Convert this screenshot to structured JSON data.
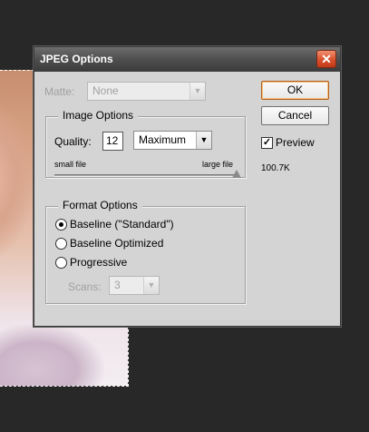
{
  "dialog": {
    "title": "JPEG Options",
    "close_glyph": "✕"
  },
  "matte": {
    "label": "Matte:",
    "value": "None"
  },
  "image_options": {
    "legend": "Image Options",
    "quality_label": "Quality:",
    "quality_value": "12",
    "quality_preset": "Maximum",
    "small_file": "small file",
    "large_file": "large file",
    "slider_level_fraction": 1.0
  },
  "format_options": {
    "legend": "Format Options",
    "options": [
      {
        "label": "Baseline (\"Standard\")",
        "selected": true
      },
      {
        "label": "Baseline Optimized",
        "selected": false
      },
      {
        "label": "Progressive",
        "selected": false
      }
    ],
    "scans_label": "Scans:",
    "scans_value": "3"
  },
  "buttons": {
    "ok": "OK",
    "cancel": "Cancel"
  },
  "preview": {
    "label": "Preview",
    "checked": true,
    "check_glyph": "✓",
    "file_size": "100.7K"
  },
  "icons": {
    "dropdown_arrow": "▼"
  },
  "colors": {
    "dialog_bg": "#d4d4d4",
    "close_button": "#d9502c",
    "default_button_border": "#b3601c"
  }
}
